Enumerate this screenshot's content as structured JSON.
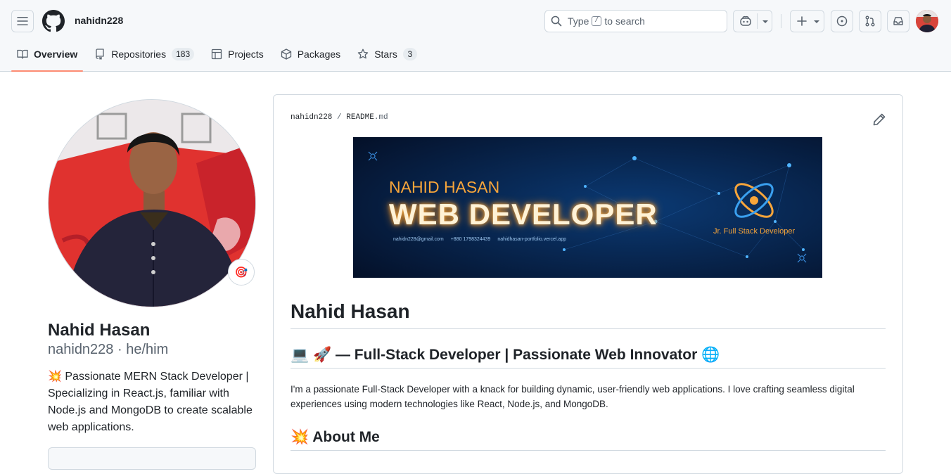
{
  "header": {
    "username": "nahidn228",
    "search": {
      "prefix": "Type",
      "key": "/",
      "suffix": "to search"
    }
  },
  "tabs": [
    {
      "label": "Overview",
      "active": true
    },
    {
      "label": "Repositories",
      "count": "183"
    },
    {
      "label": "Projects"
    },
    {
      "label": "Packages"
    },
    {
      "label": "Stars",
      "count": "3"
    }
  ],
  "profile": {
    "name": "Nahid Hasan",
    "login_line": "nahidn228 · he/him",
    "bio": "💥 Passionate MERN Stack Developer | Specializing in React.js, familiar with Node.js and MongoDB to create scalable web applications.",
    "status_emoji": "🎯"
  },
  "readme": {
    "path_user": "nahidn228",
    "path_sep": "/",
    "path_file": "README",
    "path_ext": ".md",
    "banner": {
      "small_title": "NAHID HASAN",
      "big_title": "WEB DEVELOPER",
      "role": "Jr. Full Stack Developer",
      "email": "nahidn228@gmail.com",
      "phone": "+880 1798324439",
      "site": "nahidhasan-portfolio.vercel.app"
    },
    "h1": "Nahid Hasan",
    "h2_intro": "💻 🚀 — Full-Stack Developer | Passionate Web Innovator 🌐",
    "intro_para": "I'm a passionate Full-Stack Developer with a knack for building dynamic, user-friendly web applications. I love crafting seamless digital experiences using modern technologies like React, Node.js, and MongoDB.",
    "h2_about": "💥 About Me"
  },
  "colors": {
    "tab_underline": "#fd8c73",
    "banner_bg": "#061a3a",
    "banner_orange": "#f7a53a"
  }
}
